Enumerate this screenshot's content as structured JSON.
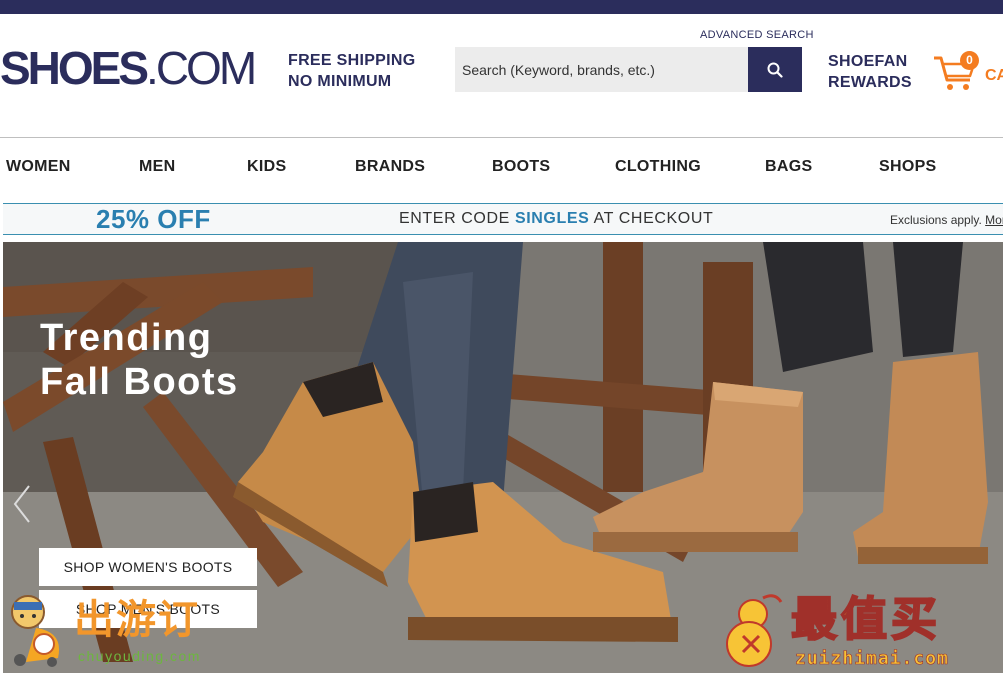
{
  "header": {
    "logo_bold": "SHOES",
    "logo_thin": ".COM",
    "free_shipping_line1": "FREE SHIPPING",
    "free_shipping_line2": "NO MINIMUM",
    "advanced_search": "ADVANCED SEARCH",
    "search_placeholder": "Search (Keyword, brands, etc.)",
    "rewards_line1": "SHOEFAN",
    "rewards_line2": "REWARDS",
    "cart_count": "0",
    "cart_label": "CA"
  },
  "nav": {
    "items": [
      "WOMEN",
      "MEN",
      "KIDS",
      "BRANDS",
      "BOOTS",
      "CLOTHING",
      "BAGS",
      "SHOPS"
    ]
  },
  "promo": {
    "discount": "25% OFF",
    "code_prefix": "ENTER CODE",
    "code": "SINGLES",
    "code_suffix": "AT CHECKOUT",
    "exclusions": "Exclusions apply.",
    "more": "Mor"
  },
  "hero": {
    "title_line1": "Trending",
    "title_line2": "Fall Boots",
    "btn_women": "SHOP WOMEN'S BOOTS",
    "btn_men": "SHOP MEN'S BOOTS"
  },
  "watermarks": {
    "left_cn": "出游订",
    "left_en": "chuyouding.com",
    "right_cn": "最值买",
    "right_en": "zuizhimai.com"
  },
  "colors": {
    "navy": "#2b2d5c",
    "orange": "#f47c20",
    "promo_blue": "#2a7fb0"
  }
}
